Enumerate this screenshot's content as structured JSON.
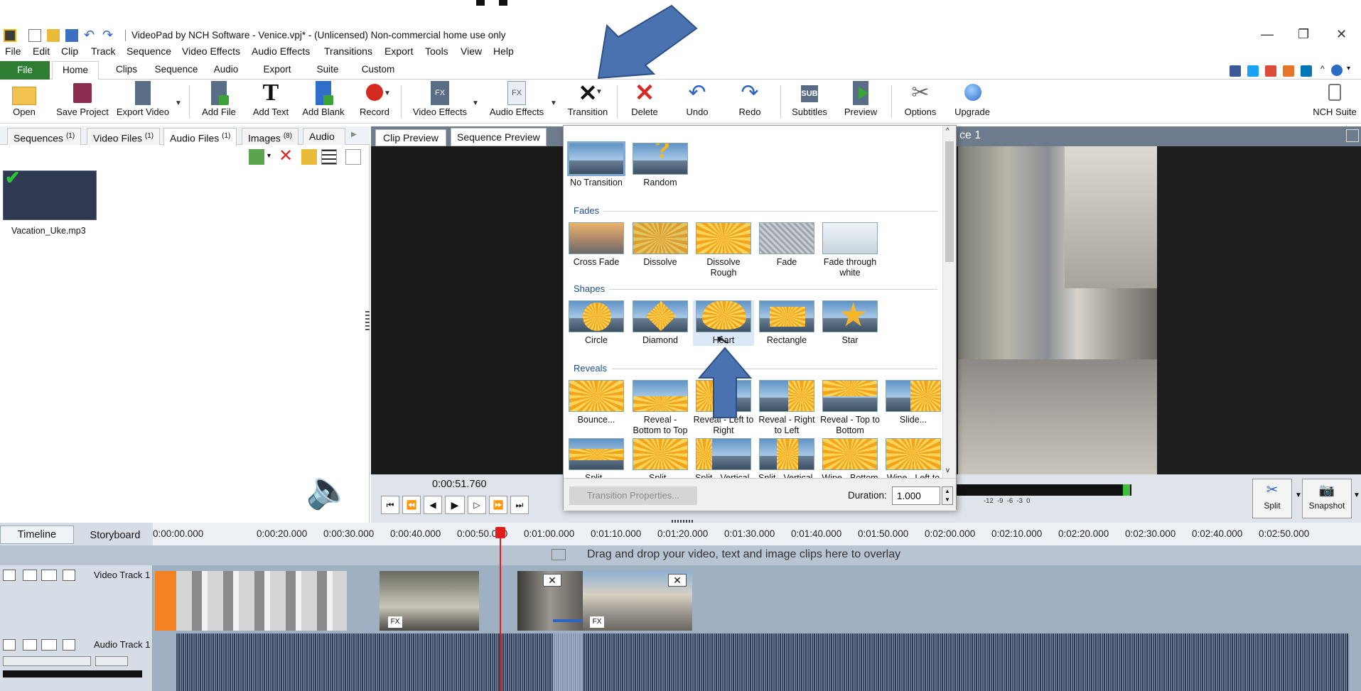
{
  "window": {
    "title": "VideoPad by NCH Software - Venice.vpj* - (Unlicensed) Non-commercial home use only",
    "controls": [
      "—",
      "❐",
      "✕"
    ]
  },
  "menu": [
    "File",
    "Edit",
    "Clip",
    "Track",
    "Sequence",
    "Video Effects",
    "Audio Effects",
    "Transitions",
    "Export",
    "Tools",
    "View",
    "Help"
  ],
  "ribbon_tabs": [
    "File",
    "Home",
    "Clips",
    "Sequence",
    "Audio",
    "Export",
    "Suite",
    "Custom"
  ],
  "toolbar": {
    "open": "Open",
    "save_project": "Save Project",
    "export_video": "Export Video",
    "add_file": "Add File",
    "add_text": "Add Text",
    "add_blank": "Add Blank",
    "record": "Record",
    "video_effects": "Video Effects",
    "audio_effects": "Audio Effects",
    "transition": "Transition",
    "delete": "Delete",
    "undo": "Undo",
    "redo": "Redo",
    "subtitles": "Subtitles",
    "preview": "Preview",
    "options": "Options",
    "upgrade": "Upgrade",
    "nch_suite": "NCH Suite",
    "fx_glyph": "FX",
    "sub_glyph": "SUB"
  },
  "bin_tabs": [
    "Sequences",
    "Video Files",
    "Audio Files",
    "Images",
    "Audio F"
  ],
  "bin_counts": [
    "(1)",
    "(1)",
    "(1)",
    "(8)"
  ],
  "bin_file": "Vacation_Uke.mp3",
  "preview": {
    "tabs": [
      "Clip Preview",
      "Sequence Preview"
    ],
    "seq_title_partial": "ce 1",
    "time": "0:00:51.760",
    "split": "Split",
    "snapshot": "Snapshot",
    "meter_labels": "-12  -9  -6  -3  0"
  },
  "transitions": {
    "top": [
      "No Transition",
      "Random"
    ],
    "sections": [
      {
        "name": "Fades",
        "items": [
          "Cross Fade",
          "Dissolve",
          "Dissolve Rough",
          "Fade",
          "Fade through white"
        ]
      },
      {
        "name": "Shapes",
        "items": [
          "Circle",
          "Diamond",
          "Heart",
          "Rectangle",
          "Star"
        ]
      },
      {
        "name": "Reveals",
        "items": [
          "Bounce...",
          "Reveal - Bottom to Top",
          "Reveal - Left to Right",
          "Reveal - Right to Left",
          "Reveal - Top to Bottom",
          "Slide..."
        ]
      }
    ],
    "partial_row": [
      "Split -",
      "Split -",
      "Split - Vertical,",
      "Split - Vertical,",
      "Wipe - Bottom",
      "Wipe - Left to"
    ],
    "properties_button": "Transition Properties...",
    "duration_label": "Duration:",
    "duration_value": "1.000"
  },
  "timeline": {
    "tabs": [
      "Timeline",
      "Storyboard"
    ],
    "ruler": [
      "0:00:00.000",
      "0:00:20.000",
      "0:00:30.000",
      "0:00:40.000",
      "0:00:50.000",
      "0:01:00.000",
      "0:01:10.000",
      "0:01:20.000",
      "0:01:30.000",
      "0:01:40.000",
      "0:01:50.000",
      "0:02:00.000",
      "0:02:10.000",
      "0:02:20.000",
      "0:02:30.000",
      "0:02:40.000",
      "0:02:50.000"
    ],
    "drop_hint": "Drag and drop your video, text and image clips here to overlay",
    "video_track": "Video Track 1",
    "audio_track": "Audio Track 1",
    "fx": "FX"
  },
  "colors": {
    "accent_green": "#2e7d32",
    "playhead": "#e31b1b",
    "annotation_arrow": "#4a72b0"
  }
}
